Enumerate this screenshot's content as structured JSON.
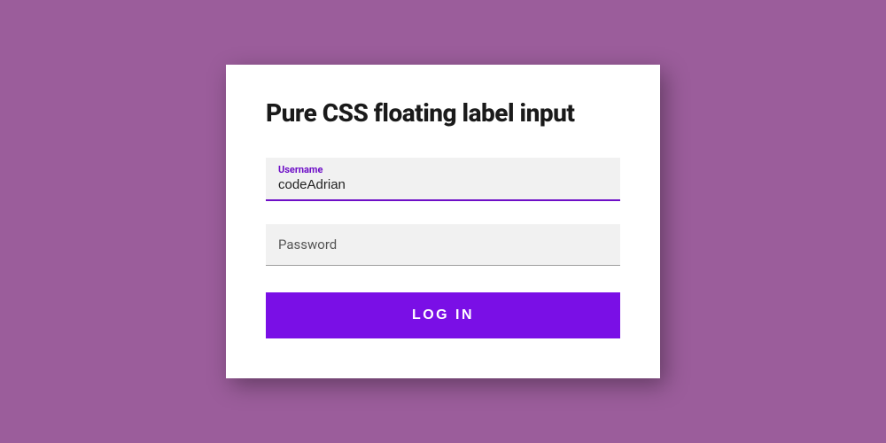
{
  "form": {
    "title": "Pure CSS floating label input",
    "username": {
      "label": "Username",
      "value": "codeAdrian"
    },
    "password": {
      "label": "Password",
      "value": ""
    },
    "submit_label": "LOG IN"
  },
  "colors": {
    "background": "#9b5d9b",
    "accent": "#6e0fc7",
    "button": "#7a0fe6"
  }
}
